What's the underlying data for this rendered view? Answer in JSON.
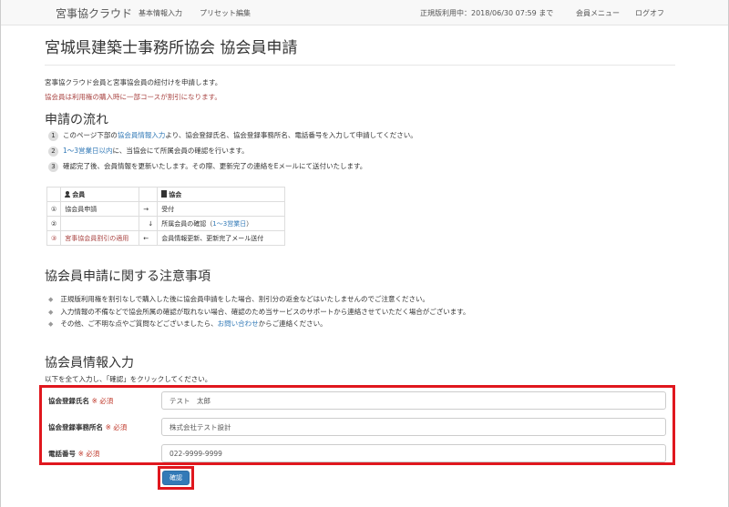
{
  "navbar": {
    "brand": "宮事協クラウド",
    "links": [
      "基本情報入力",
      "プリセット編集"
    ],
    "status": "正規版利用中：2018/06/30 07:59 まで",
    "member_menu": "会員メニュー",
    "logout": "ログオフ"
  },
  "page_title": "宮城県建築士事務所協会 協会員申請",
  "intro": {
    "line1": "宮事協クラウド会員と宮事協会員の紐付けを申請します。",
    "line2": "協会員は利用権の購入時に一部コースが割引になります。"
  },
  "flow": {
    "heading": "申請の流れ",
    "steps": [
      {
        "num": "1",
        "pre": "このページ下部の",
        "link": "協会員情報入力",
        "post": "より、協会登録氏名、協会登録事務所名、電話番号を入力して申請してください。"
      },
      {
        "num": "2",
        "pre": "",
        "link": "1〜3営業日以内",
        "post": "に、当協会にて所属会員の確認を行います。"
      },
      {
        "num": "3",
        "pre": "確認完了後、会員情報を更新いたします。その際、更新完了の連絡をEメールにて送付いたします。",
        "link": "",
        "post": ""
      }
    ],
    "table": {
      "header_member": "会員",
      "header_assoc": "協会",
      "rows": [
        {
          "num": "①",
          "member": "協会員申請",
          "arrow": "→",
          "assoc": "受付",
          "assoc_link": ""
        },
        {
          "num": "②",
          "member": "",
          "arrow": "↓",
          "assoc": "所属会員の確認（",
          "assoc_link": "1〜3営業日",
          "assoc_post": "）"
        },
        {
          "num": "③",
          "member": "宮事協会員割引の適用",
          "arrow": "←",
          "assoc": "会員情報更新、更新完了メール送付",
          "assoc_link": ""
        }
      ]
    }
  },
  "notes": {
    "heading": "協会員申請に関する注意事項",
    "items": [
      {
        "text": "正規版利用権を割引なしで購入した後に協会員申請をした場合、割引分の返金などはいたしませんのでご注意ください。"
      },
      {
        "text": "入力情報の不備などで協会所属の確認が取れない場合、確認のため当サービスのサポートから連絡させていただく場合がございます。"
      },
      {
        "pre": "その他、ご不明な点やご質問などございましたら、",
        "link": "お問い合わせ",
        "post": "からご連絡ください。"
      }
    ]
  },
  "form": {
    "heading": "協会員情報入力",
    "instruction": "以下を全て入力し、「確認」をクリックしてください。",
    "required": "※ 必須",
    "fields": [
      {
        "label": "協会登録氏名",
        "value": "テスト　太郎"
      },
      {
        "label": "協会登録事務所名",
        "value": "株式会社テスト設計"
      },
      {
        "label": "電話番号",
        "value": "022-9999-9999"
      }
    ],
    "confirm_button": "確認"
  }
}
